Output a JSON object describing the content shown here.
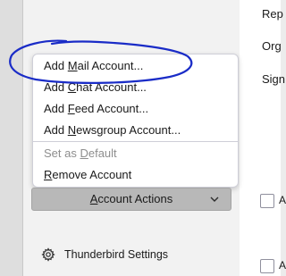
{
  "content": {
    "labels": [
      "Rep",
      "Org",
      "Sign"
    ],
    "checkbox_tail": "A"
  },
  "menu": {
    "items": [
      {
        "label": "Add Mail Account...",
        "access": "M",
        "enabled": true
      },
      {
        "label": "Add Chat Account...",
        "access": "C",
        "enabled": true
      },
      {
        "label": "Add Feed Account...",
        "access": "F",
        "enabled": true
      },
      {
        "label": "Add Newsgroup Account...",
        "access": "N",
        "enabled": true
      },
      {
        "label": "Set as Default",
        "access": "D",
        "enabled": false
      },
      {
        "label": "Remove Account",
        "access": "R",
        "enabled": true
      }
    ]
  },
  "account_actions": {
    "label": "Account Actions",
    "access": "A"
  },
  "settings": {
    "label": "Thunderbird Settings"
  },
  "icons": {
    "chevron": "chevron-down-icon",
    "settings": "gear-icon"
  },
  "colors": {
    "annotation": "#1a2cc7",
    "button_bg": "#b8b8b8",
    "sidebar_bg": "#f2f2f2"
  }
}
